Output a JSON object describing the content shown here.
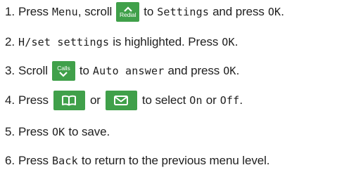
{
  "steps": [
    {
      "number": "1.",
      "parts": [
        "Press",
        "Menu",
        ", scroll",
        "to",
        "Settings",
        "and press",
        "OK",
        "."
      ],
      "key_label": "Redial",
      "key_icon": "chevron-up-icon"
    },
    {
      "number": "2.",
      "parts": [
        "H/set settings",
        "is highlighted. Press",
        "OK",
        "."
      ]
    },
    {
      "number": "3.",
      "parts": [
        "Scroll",
        "to",
        "Auto answer",
        "and press",
        "OK",
        "."
      ],
      "key_label": "Calls",
      "key_icon": "chevron-down-icon"
    },
    {
      "number": "4.",
      "parts": [
        "Press",
        "or",
        "to select",
        "On",
        "or",
        "Off",
        "."
      ],
      "key1_icon": "phonebook-icon",
      "key2_icon": "envelope-icon"
    },
    {
      "number": "5.",
      "parts": [
        "Press",
        "OK",
        "to save."
      ]
    },
    {
      "number": "6.",
      "parts": [
        "Press",
        "Back",
        "to return to the previous menu level."
      ]
    }
  ],
  "colors": {
    "key_green": "#40a04a",
    "text": "#1e1e1e"
  }
}
